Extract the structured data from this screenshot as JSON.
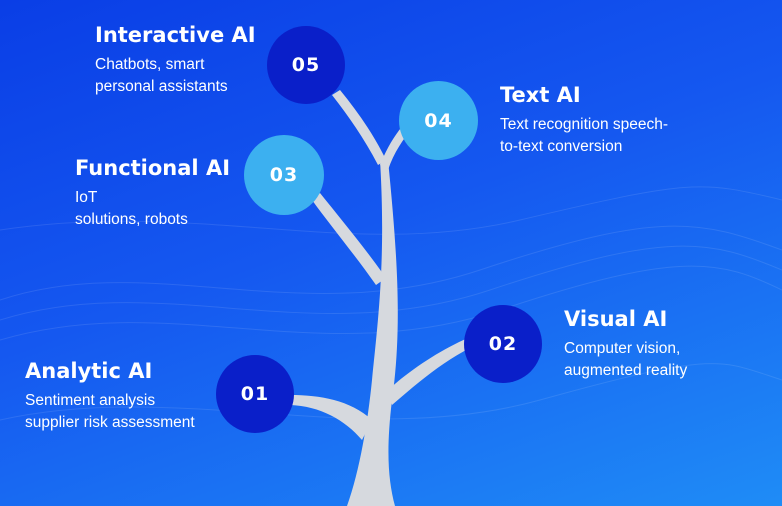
{
  "items": [
    {
      "number": "01",
      "title": "Analytic AI",
      "description": "Sentiment analysis\nsupplier risk assessment",
      "style": "dark"
    },
    {
      "number": "02",
      "title": "Visual AI",
      "description": "Computer vision,\naugmented reality",
      "style": "dark"
    },
    {
      "number": "03",
      "title": "Functional AI",
      "description": "IoT\nsolutions, robots",
      "style": "light"
    },
    {
      "number": "04",
      "title": "Text AI",
      "description": "Text recognition speech-\nto-text conversion",
      "style": "light"
    },
    {
      "number": "05",
      "title": "Interactive AI",
      "description": "Chatbots, smart\npersonal assistants",
      "style": "dark"
    }
  ],
  "colors": {
    "background_start": "#0a3ee6",
    "background_end": "#1f8cf6",
    "node_dark": "#0a1fc9",
    "node_light": "#3cb0f0",
    "trunk": "#d6d9de"
  }
}
